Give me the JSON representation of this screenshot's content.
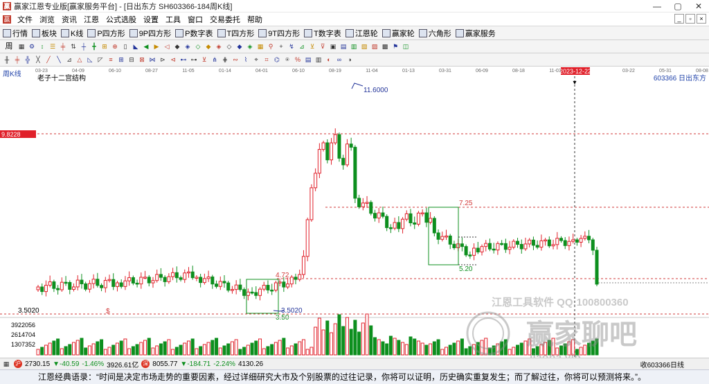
{
  "window": {
    "title": "赢家江恩专业版[赢家服务平台] - [日出东方  SH603366-184周K线]",
    "app_icon": "yingjia-app-icon",
    "controls": [
      "—",
      "▢",
      "✕"
    ]
  },
  "menu": {
    "items": [
      "文件",
      "浏览",
      "资讯",
      "江恩",
      "公式选股",
      "设置",
      "工具",
      "窗口",
      "交易委托",
      "帮助"
    ],
    "mdi_controls": [
      "_",
      "▫",
      "×"
    ]
  },
  "toolbar1": {
    "items": [
      {
        "icon": "quote-list-icon",
        "label": "行情"
      },
      {
        "icon": "sector-icon",
        "label": "板块"
      },
      {
        "icon": "kline-icon",
        "label": "K线"
      },
      {
        "icon": "p-square-icon",
        "label": "P四方形"
      },
      {
        "icon": "9p-square-icon",
        "label": "9P四方形"
      },
      {
        "icon": "pn-table-icon",
        "label": "P数字表"
      },
      {
        "icon": "t-square-icon",
        "label": "T四方形"
      },
      {
        "icon": "9t-square-icon",
        "label": "9T四方形"
      },
      {
        "icon": "tn-table-icon",
        "label": "T数字表"
      },
      {
        "icon": "gann-wheel-icon",
        "label": "江恩轮"
      },
      {
        "icon": "yingjia-wheel-icon",
        "label": "赢家轮"
      },
      {
        "icon": "hexagon-icon",
        "label": "六角形"
      },
      {
        "icon": "service-icon",
        "label": "赢家服务"
      }
    ]
  },
  "toolbar2": {
    "period_label": "周",
    "tools_count": 38
  },
  "toolbar3": {
    "tools_count": 34
  },
  "chart": {
    "period_label": "周K线",
    "overlay_title": "老子十二宫结构",
    "stock_label": "603366 日出东方",
    "date_axis": [
      "03-23",
      "04-09",
      "06-10",
      "08-27",
      "11-05",
      "01-14",
      "04-01",
      "06-10",
      "08-19",
      "11-04",
      "01-13",
      "03-31",
      "06-09",
      "08-18",
      "11-03",
      "2023-12-22",
      "03-22",
      "05-31",
      "08-08"
    ],
    "cursor_date": "2023-12-22",
    "cursor_price": "9.8228",
    "price_annotations": {
      "high": "11.6000",
      "box1_top": "4.72",
      "box1_bottom": "3.50",
      "box1_low_label": "3.5020",
      "box2_top": "7.25",
      "box2_bottom": "5.20",
      "dollar_marker": "$"
    },
    "volume_axis": [
      "3922056",
      "2614704",
      "1307352"
    ],
    "left_price_label": "3.5020",
    "colors": {
      "up": "#e0202a",
      "down": "#0d8f1e",
      "dash": "#d23a3a",
      "box": "#0d8f1e",
      "cursor": "#333333"
    },
    "watermark": {
      "line1": "江恩工具软件  QQ:100800360",
      "brand": "赢家聊吧",
      "url": "ijaoba.vip"
    }
  },
  "status": {
    "sh_value": "2730.15",
    "sh_change": "▼-40.59",
    "sh_pct": "-1.46%",
    "sh_amount": "3926.61亿",
    "sz_value": "8055.77",
    "sz_change": "▼-184.71",
    "sz_pct": "-2.24%",
    "sz_amount": "4130.26",
    "right_text": "收603366日线"
  },
  "quote": {
    "text": "江恩经典语录：“时间是决定市场走势的重要因素，经过详细研究大市及个别股票的过往记录，你将可以证明，历史确实重复发生；而了解过往，你将可以预测将来。”。"
  }
}
